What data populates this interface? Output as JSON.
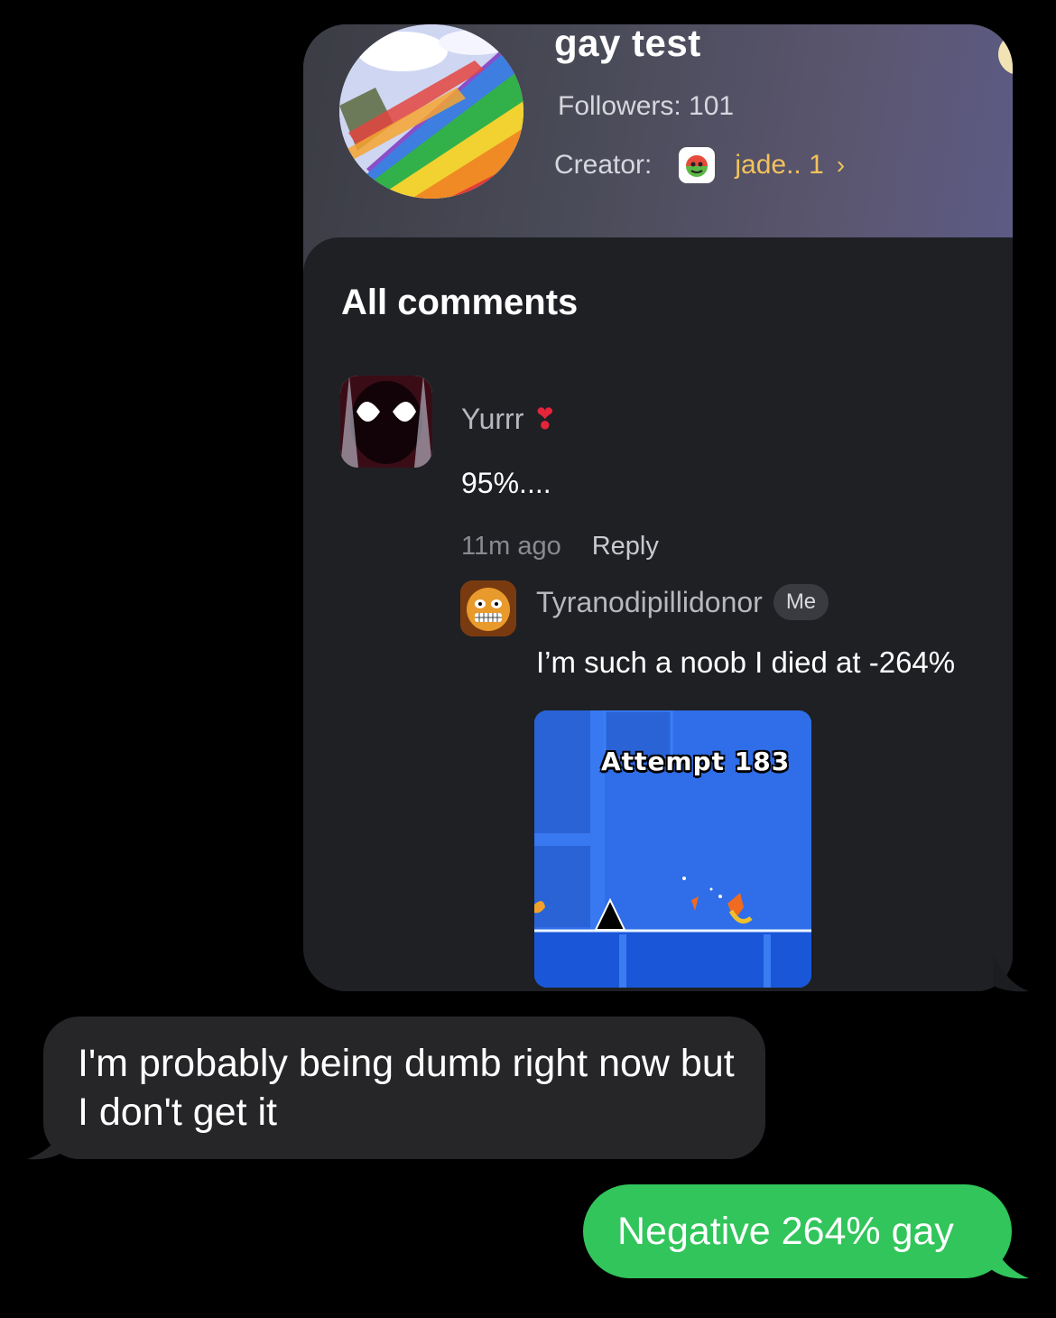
{
  "shared_screenshot": {
    "playlist_title": "gay test",
    "followers": "Followers: 101",
    "creator_label": "Creator:",
    "creator_name": "jade.. 1",
    "chevron": "›",
    "comments_title": "All comments",
    "comment": {
      "username": "Yurrr",
      "heart": "❣",
      "text": "95%....",
      "time": "11m ago",
      "reply_label": "Reply"
    },
    "reply": {
      "username": "Tyranodipillidonor",
      "badge": "Me",
      "text": "I’m such a noob I died at -264%",
      "image_text": "Attempt 183"
    }
  },
  "messages": [
    {
      "direction": "incoming",
      "text": "I'm probably being dumb right now but I don't get it"
    },
    {
      "direction": "outgoing",
      "text": "Negative 264% gay"
    }
  ],
  "colors": {
    "background": "#000000",
    "incoming_bubble": "#262628",
    "outgoing_bubble": "#31c55b",
    "creator_accent": "#f2c25c",
    "heart": "#e5253a",
    "game_blue": "#2e6fe6"
  }
}
